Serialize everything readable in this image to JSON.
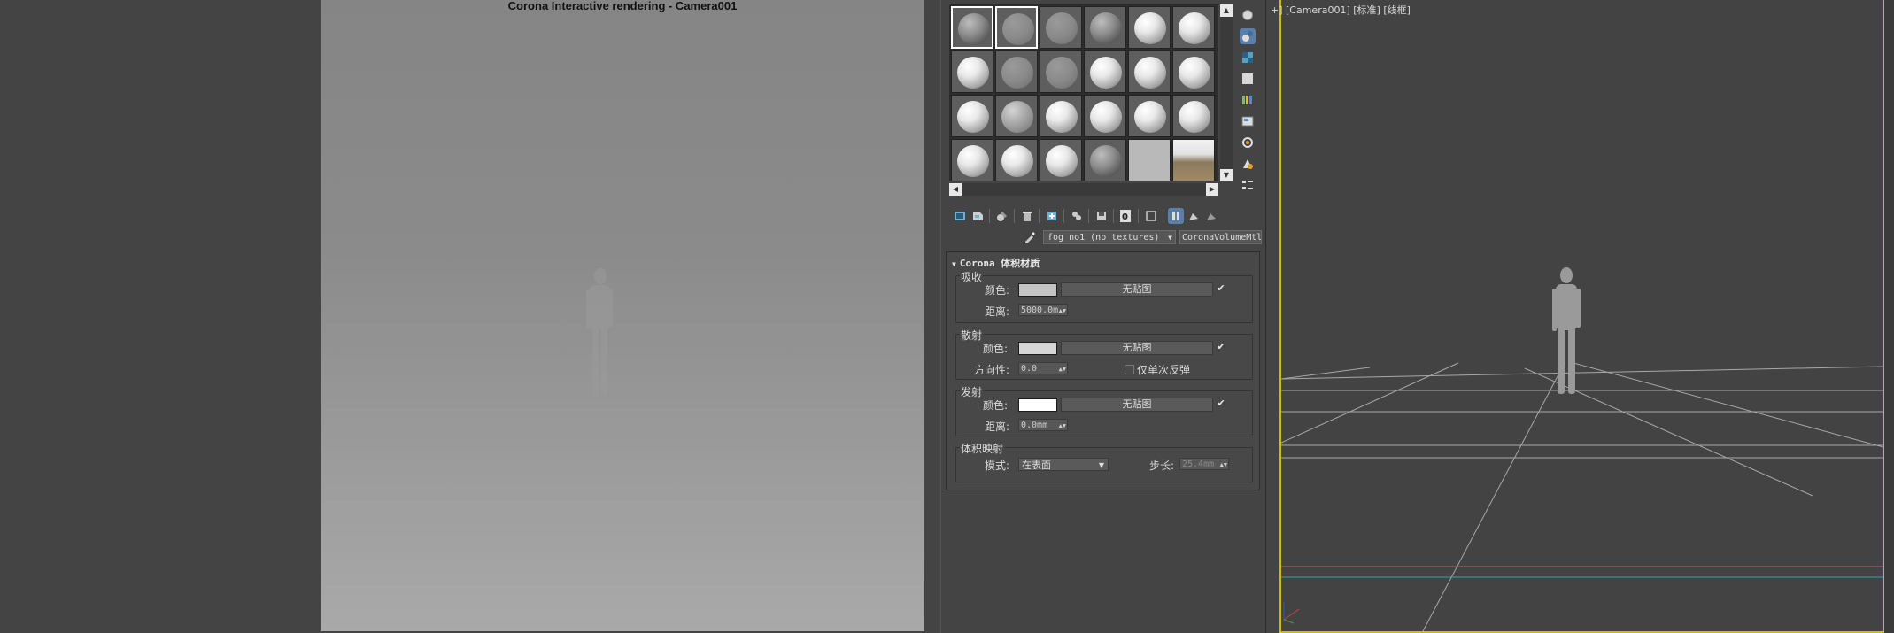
{
  "render_window": {
    "title": "Corona Interactive rendering - Camera001"
  },
  "material_editor": {
    "sample_slots": [
      {
        "style": "dark",
        "selected": true
      },
      {
        "style": "flat",
        "selected": true
      },
      {
        "style": "flat",
        "selected": false
      },
      {
        "style": "dark",
        "selected": false
      },
      {
        "style": "light",
        "selected": false
      },
      {
        "style": "light",
        "selected": false
      },
      {
        "style": "light",
        "selected": false
      },
      {
        "style": "flat",
        "selected": false
      },
      {
        "style": "flat",
        "selected": false
      },
      {
        "style": "light",
        "selected": false
      },
      {
        "style": "light",
        "selected": false
      },
      {
        "style": "light",
        "selected": false
      },
      {
        "style": "light",
        "selected": false
      },
      {
        "style": "noise",
        "selected": false
      },
      {
        "style": "light",
        "selected": false
      },
      {
        "style": "light",
        "selected": false
      },
      {
        "style": "light",
        "selected": false
      },
      {
        "style": "light",
        "selected": false
      },
      {
        "style": "light",
        "selected": false
      },
      {
        "style": "light",
        "selected": false
      },
      {
        "style": "light",
        "selected": false
      },
      {
        "style": "dark",
        "selected": false
      },
      {
        "style": "plain",
        "selected": false
      },
      {
        "style": "photo",
        "selected": false
      }
    ],
    "material_name": "fog no1 (no textures)",
    "material_type": "CoronaVolumeMtl",
    "rollout_title": "Corona 体积材质",
    "absorption": {
      "label": "吸收",
      "color_label": "颜色:",
      "color": "#c4c4c4",
      "map_button": "无贴图",
      "distance_label": "距离:",
      "distance_value": "5000.0m"
    },
    "scattering": {
      "label": "散射",
      "color_label": "颜色:",
      "color": "#d6d6d6",
      "map_button": "无贴图",
      "directionality_label": "方向性:",
      "directionality_value": "0.0",
      "single_bounce_label": "仅单次反弹"
    },
    "emission": {
      "label": "发射",
      "color_label": "颜色:",
      "color": "#ffffff",
      "map_button": "无贴图",
      "distance_label": "距离:",
      "distance_value": "0.0mm"
    },
    "volume_mapping": {
      "label": "体积映射",
      "mode_label": "模式:",
      "mode_value": "在表面",
      "step_label": "步长:",
      "step_value": "25.4mm"
    }
  },
  "viewport": {
    "label": "+] [Camera001] [标准] [线框]",
    "border_color": "#c8c000"
  }
}
